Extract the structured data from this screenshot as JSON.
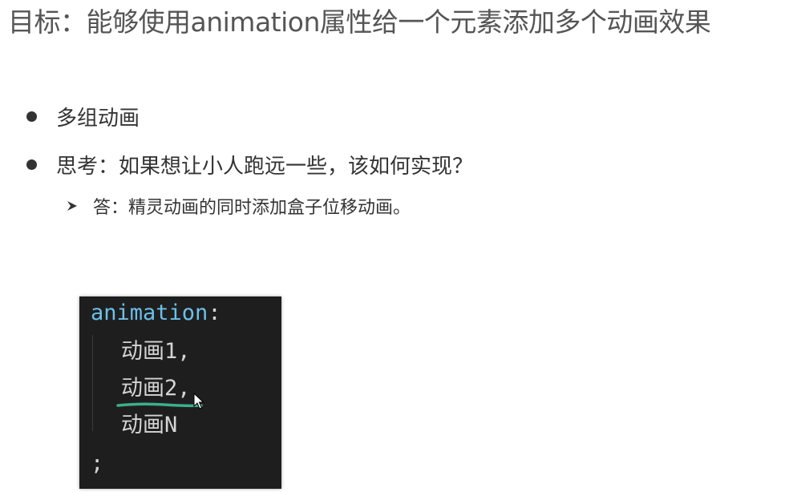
{
  "slide": {
    "title": "目标：能够使用animation属性给一个元素添加多个动画效果",
    "bullets": [
      {
        "text": "多组动画"
      },
      {
        "text": "思考：如果想让小人跑远一些，该如何实现？"
      }
    ],
    "sub_bullet": {
      "text": "答：精灵动画的同时添加盒子位移动画。"
    }
  },
  "code": {
    "keyword": "animation",
    "colon": ":",
    "items": [
      "动画1,",
      "动画2,",
      "动画N"
    ],
    "terminator": ";"
  },
  "colors": {
    "code_background": "#1e1e1e",
    "keyword": "#6cc0ea",
    "code_text": "#d4d4d4",
    "underline_annotation": "#3cae8a"
  }
}
